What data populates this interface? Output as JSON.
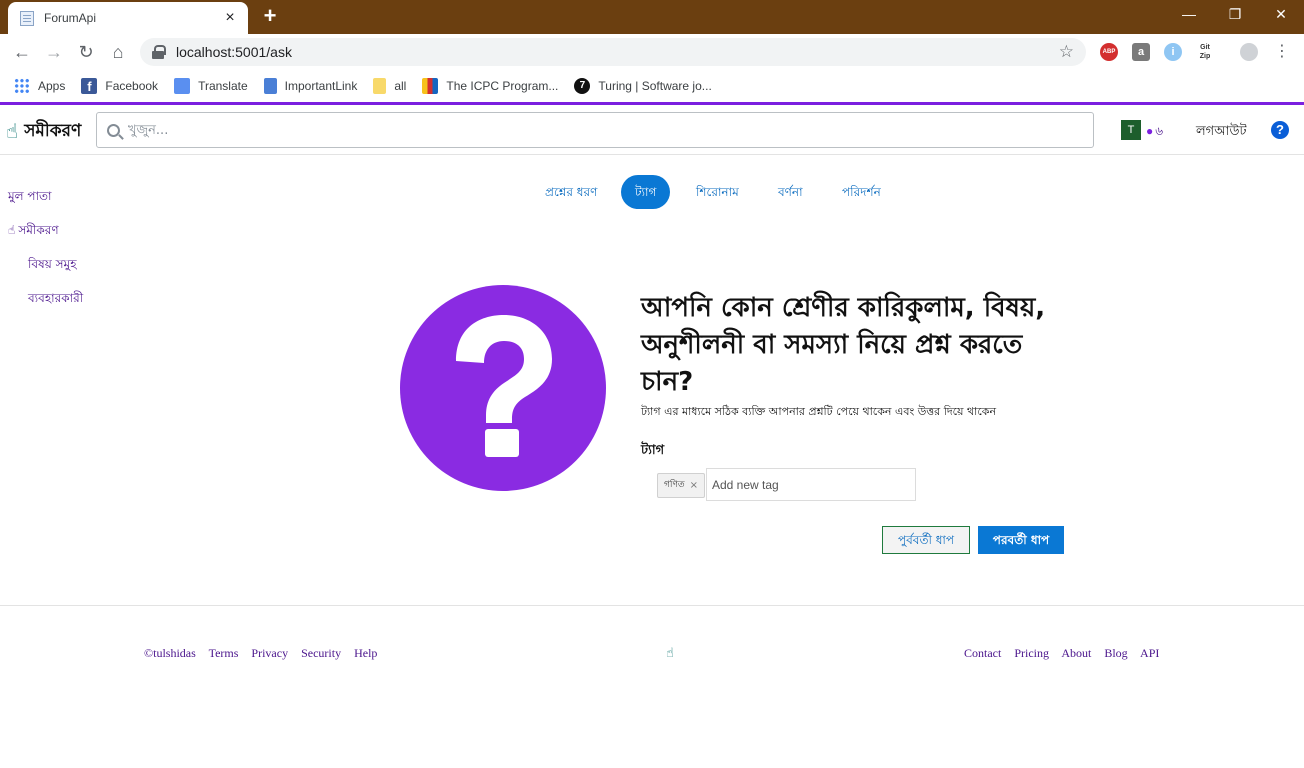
{
  "browser": {
    "tab_title": "ForumApi",
    "tab_close": "×",
    "new_tab": "+",
    "url": "localhost:5001/ask",
    "window_controls": [
      "—",
      "❐",
      "✕"
    ],
    "extensions": [
      "ABP",
      "a",
      "i",
      "Git Zip"
    ],
    "bookmarks": [
      {
        "label": "Apps",
        "icon": "apps-grid-icon"
      },
      {
        "label": "Facebook",
        "icon": "facebook-icon"
      },
      {
        "label": "Translate",
        "icon": "translate-icon"
      },
      {
        "label": "ImportantLink",
        "icon": "document-icon"
      },
      {
        "label": "all",
        "icon": "folder-icon"
      },
      {
        "label": "The ICPC Program...",
        "icon": "icpc-icon"
      },
      {
        "label": "Turing | Software jo...",
        "icon": "turing-icon"
      }
    ]
  },
  "header": {
    "brand": "সমীকরণ",
    "search_placeholder": "খুজুন...",
    "avatar_letter": "T",
    "reputation": "৬",
    "logout": "লগআউট",
    "help": "?"
  },
  "leftnav": {
    "home": "মুল পাতা",
    "site": "সমীকরণ",
    "topics": "বিষয় সমুহ",
    "users": "ব্যবহারকারী"
  },
  "steps": [
    {
      "label": "প্রশ্নের ধরণ",
      "active": false
    },
    {
      "label": "ট্যাগ",
      "active": true
    },
    {
      "label": "শিরোনাম",
      "active": false
    },
    {
      "label": "বর্ণনা",
      "active": false
    },
    {
      "label": "পরিদর্শন",
      "active": false
    }
  ],
  "main": {
    "heading": "আপনি কোন শ্রেণীর কারিকুলাম, বিষয়, অনুশীলনী বা সমস্যা নিয়ে প্রশ্ন করতে চান?",
    "subheading": "ট্যাগ এর মাধ্যমে সঠিক ব্যক্তি আপনার প্রশ্নটি পেয়ে থাকেন এবং উত্তর দিয়ে থাকেন",
    "tag_label": "ট্যাগ",
    "tags": [
      "গণিত"
    ],
    "tag_remove": "×",
    "tag_input_placeholder": "Add new tag",
    "prev_button": "পুর্ববর্তী ধাপ",
    "next_button": "পরবর্তী ধাপ",
    "icon_color": "#8a2be2"
  },
  "footer": {
    "left_links": [
      "©tulshidas",
      "Terms",
      "Privacy",
      "Security",
      "Help"
    ],
    "right_links": [
      "Contact",
      "Pricing",
      "About",
      "Blog",
      "API"
    ]
  },
  "colors": {
    "tabstrip": "#6b3f10",
    "accent_line": "#7b1fe0",
    "primary": "#0a78d4",
    "link": "#4a148c"
  }
}
